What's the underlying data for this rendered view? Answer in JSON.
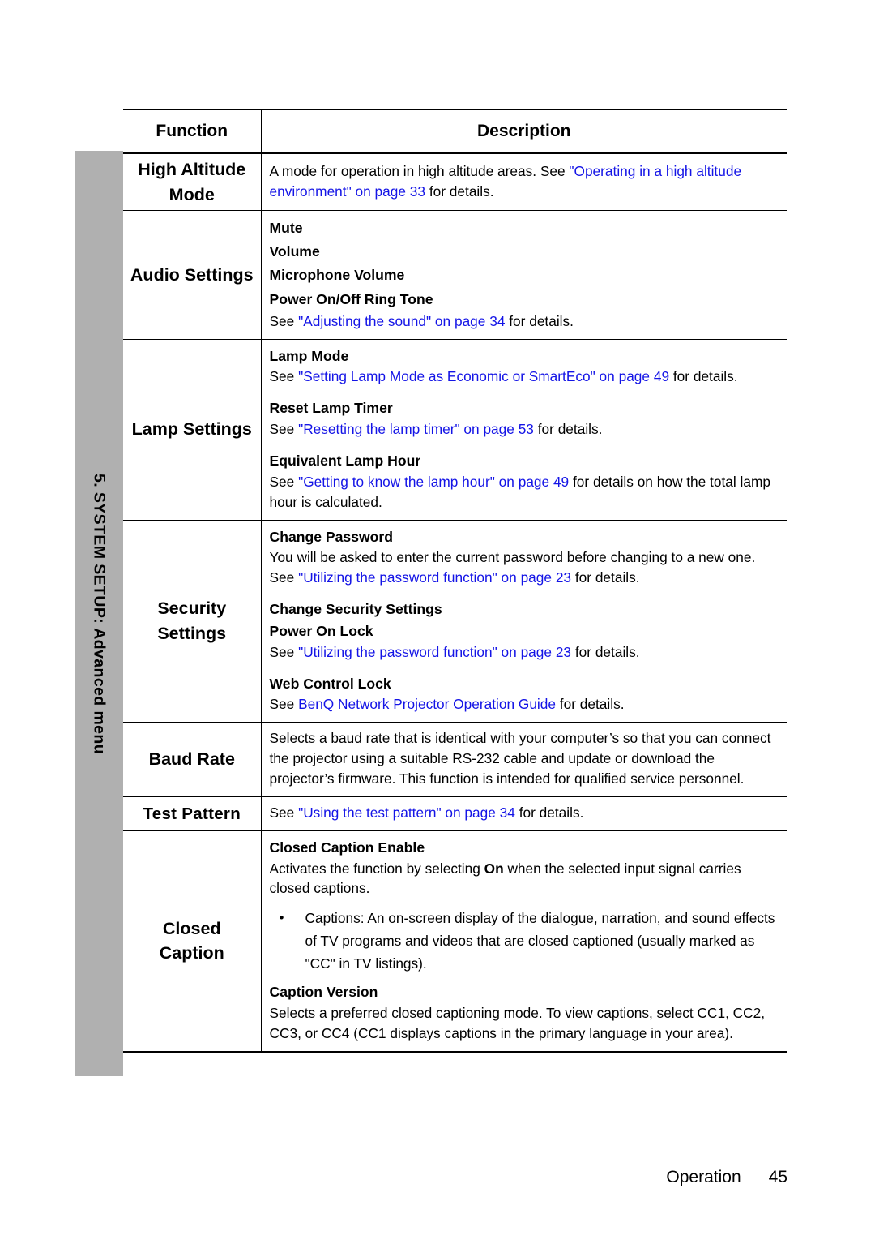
{
  "sidebar": {
    "label": "5. SYSTEM SETUP: Advanced menu"
  },
  "table": {
    "headers": {
      "function": "Function",
      "description": "Description"
    },
    "rows": [
      {
        "function": "High Altitude Mode",
        "desc_plain_1": "A mode for operation in high altitude areas. See ",
        "desc_link_1": "\"Operating in a high altitude environment\" on page 33",
        "desc_plain_2": " for details."
      },
      {
        "function": "Audio Settings",
        "item_1": "Mute",
        "item_2": "Volume",
        "item_3": "Microphone Volume",
        "item_4": "Power On/Off Ring Tone",
        "see_pre": "See ",
        "see_link": "\"Adjusting the sound\" on page 34",
        "see_post": " for details."
      },
      {
        "function": "Lamp Settings",
        "sub_1": "Lamp Mode",
        "sub_1_pre": "See ",
        "sub_1_link": "\"Setting Lamp Mode as Economic or SmartEco\" on page 49",
        "sub_1_post": " for details.",
        "sub_2": "Reset Lamp Timer",
        "sub_2_pre": "See ",
        "sub_2_link": "\"Resetting the lamp timer\" on page 53",
        "sub_2_post": " for details.",
        "sub_3": "Equivalent Lamp Hour",
        "sub_3_pre": "See ",
        "sub_3_link": "\"Getting to know the lamp hour\" on page 49",
        "sub_3_post": " for details on how the total lamp hour is calculated."
      },
      {
        "function": "Security Settings",
        "sub_1": "Change Password",
        "sub_1_pre": "You will be asked to enter the current password before changing to a new one. See ",
        "sub_1_link": "\"Utilizing the password function\" on page 23",
        "sub_1_post": " for details.",
        "sub_2": "Change Security Settings",
        "sub_3": "Power On Lock",
        "sub_3_pre": "See ",
        "sub_3_link": "\"Utilizing the password function\" on page 23",
        "sub_3_post": " for details.",
        "sub_4": "Web Control Lock",
        "sub_4_pre": "See ",
        "sub_4_link": "BenQ Network Projector Operation Guide",
        "sub_4_post": " for details."
      },
      {
        "function": "Baud Rate",
        "desc": "Selects a baud rate that is identical with your computer’s so that you can connect the projector using a suitable RS-232 cable and update or download the projector’s firmware. This function is intended for qualified service personnel."
      },
      {
        "function": "Test Pattern",
        "pre": "See ",
        "link": "\"Using the test pattern\" on page 34",
        "post": " for details."
      },
      {
        "function": "Closed Caption",
        "sub_1": "Closed Caption Enable",
        "sub_1_pre": "Activates the function by selecting ",
        "sub_1_bold": "On",
        "sub_1_post": " when the selected input signal carries closed captions.",
        "bullet_1": "Captions: An on-screen display of the dialogue, narration, and sound effects of TV programs and videos that are closed captioned (usually marked as \"CC\" in TV listings).",
        "bullet_char": "•",
        "sub_2": "Caption Version",
        "sub_2_text": "Selects a preferred closed captioning mode. To view captions, select CC1, CC2, CC3, or CC4 (CC1 displays captions in the primary language in your area)."
      }
    ]
  },
  "footer": {
    "section": "Operation",
    "page_number": "45"
  },
  "colors": {
    "link": "#1414e6",
    "sidebar_gray": "#b0b0b0",
    "text": "#000000"
  }
}
